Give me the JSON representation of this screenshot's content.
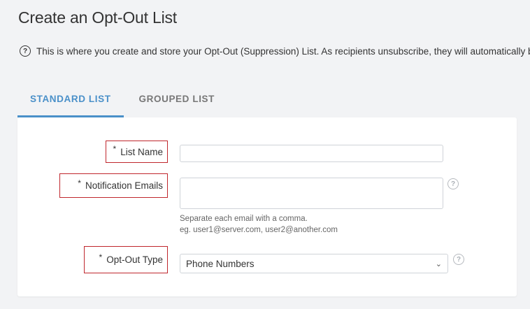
{
  "page": {
    "title": "Create an Opt-Out List",
    "info_text": "This is where you create and store your Opt-Out (Suppression) List. As recipients unsubscribe, they will automatically be added to this list."
  },
  "tabs": [
    {
      "label": "STANDARD LIST",
      "active": true
    },
    {
      "label": "GROUPED LIST",
      "active": false
    }
  ],
  "form": {
    "list_name": {
      "required_mark": "*",
      "label": "List Name",
      "value": "",
      "placeholder": ""
    },
    "notification_emails": {
      "required_mark": "*",
      "label": "Notification Emails",
      "value": "",
      "hint_line1": "Separate each email with a comma.",
      "hint_line2": "eg. user1@server.com, user2@another.com"
    },
    "opt_out_type": {
      "required_mark": "*",
      "label": "Opt-Out Type",
      "selected": "Phone Numbers"
    }
  },
  "icons": {
    "help": "question-circle-icon",
    "dropdown": "chevron-down-icon"
  },
  "colors": {
    "accent": "#4a90c9",
    "label_outline": "#c0272d",
    "background": "#f2f3f5"
  }
}
